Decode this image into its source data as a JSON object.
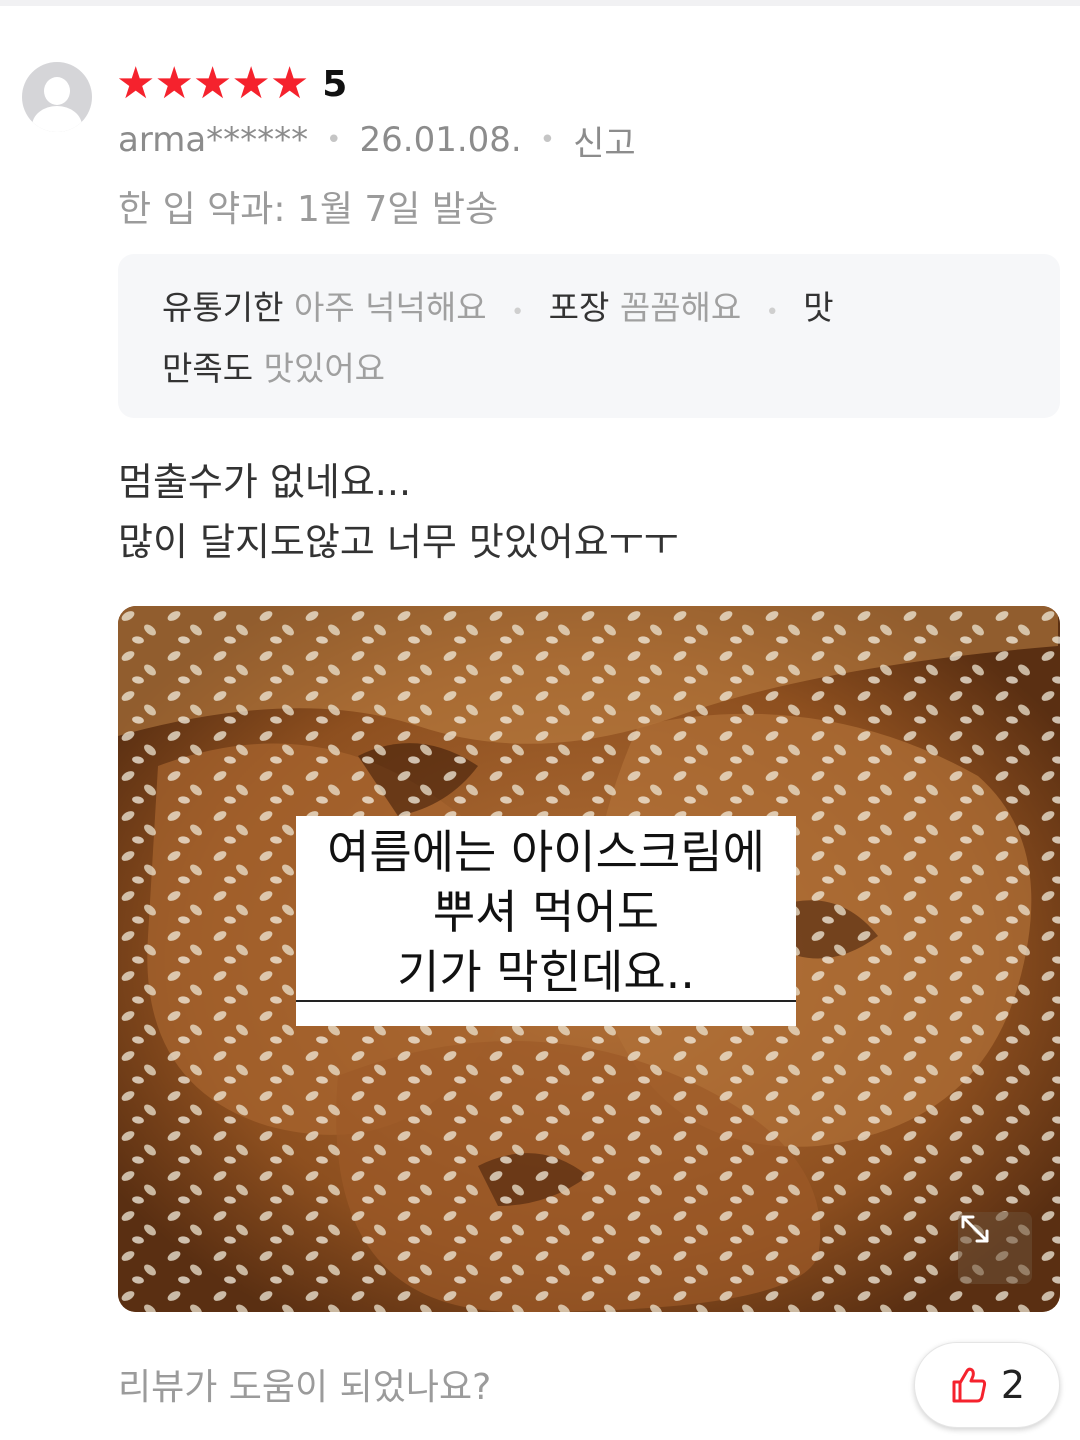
{
  "review": {
    "rating_value": "5",
    "star_count": 5,
    "username": "arma******",
    "date": "26.01.08.",
    "report_label": "신고",
    "option": "한 입 약과: 1월 7일 발송",
    "tags": {
      "expiry_key": "유통기한",
      "expiry_value": "아주 넉넉해요",
      "packaging_key": "포장",
      "packaging_value": "꼼꼼해요",
      "taste_key_line1": "맛",
      "taste_key_line2": "만족도",
      "taste_value": "맛있어요"
    },
    "text": "멈출수가 없네요...\n많이 달지도않고 너무 맛있어요ㅜㅜ",
    "photo": {
      "caption_line1": "여름에는 아이스크림에",
      "caption_line2": "뿌셔 먹어도",
      "caption_line3": "기가 막힌데요.."
    },
    "helpful_question": "리뷰가 도움이 되었나요?",
    "like_count": "2"
  },
  "icons": {
    "star": "star-icon",
    "avatar": "avatar-placeholder",
    "expand": "expand-icon",
    "thumbs_up": "thumbs-up-icon"
  },
  "colors": {
    "star": "#f5222d",
    "thumbs_up": "#f5222d",
    "tag_box_bg": "#f6f7f9"
  }
}
